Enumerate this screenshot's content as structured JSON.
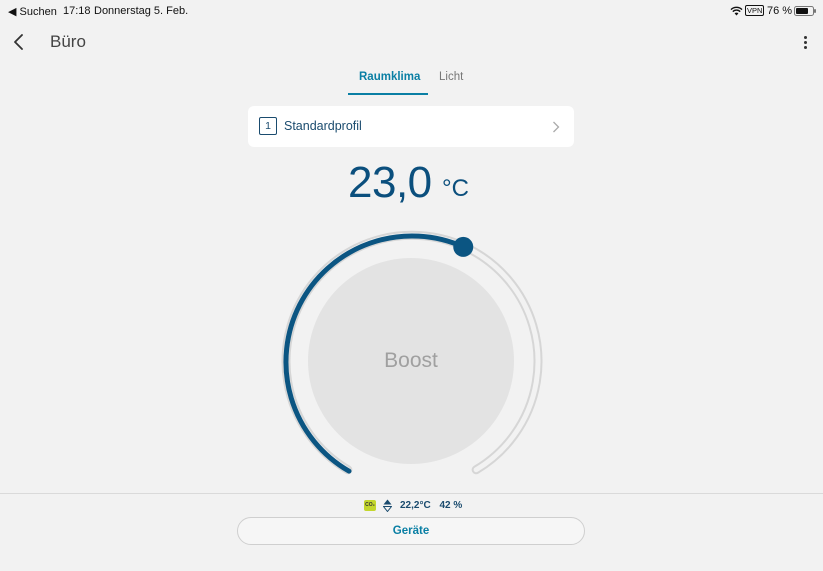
{
  "status_bar": {
    "back_app": "◀ Suchen",
    "time": "17:18",
    "date": "Donnerstag 5. Feb.",
    "vpn": "VPN",
    "battery": "76 %"
  },
  "nav": {
    "title": "Büro",
    "back_icon": "chevron-left-icon",
    "menu_icon": "more-vertical-icon"
  },
  "tabs": [
    {
      "label": "Raumklima",
      "active": true
    },
    {
      "label": "Licht",
      "active": false
    }
  ],
  "profile": {
    "number": "1",
    "name": "Standardprofil"
  },
  "temperature": {
    "value": "23,0",
    "unit": "°C",
    "dial_fraction": 0.58
  },
  "boost_label": "Boost",
  "sensors": {
    "co2_label": "CO₂",
    "co2_color": "#c3d62c",
    "room_temp": "22,2°C",
    "humidity": "42 %"
  },
  "devices_button": "Geräte",
  "colors": {
    "accent": "#0a7fa4",
    "dial_blue": "#0b4f7d"
  }
}
